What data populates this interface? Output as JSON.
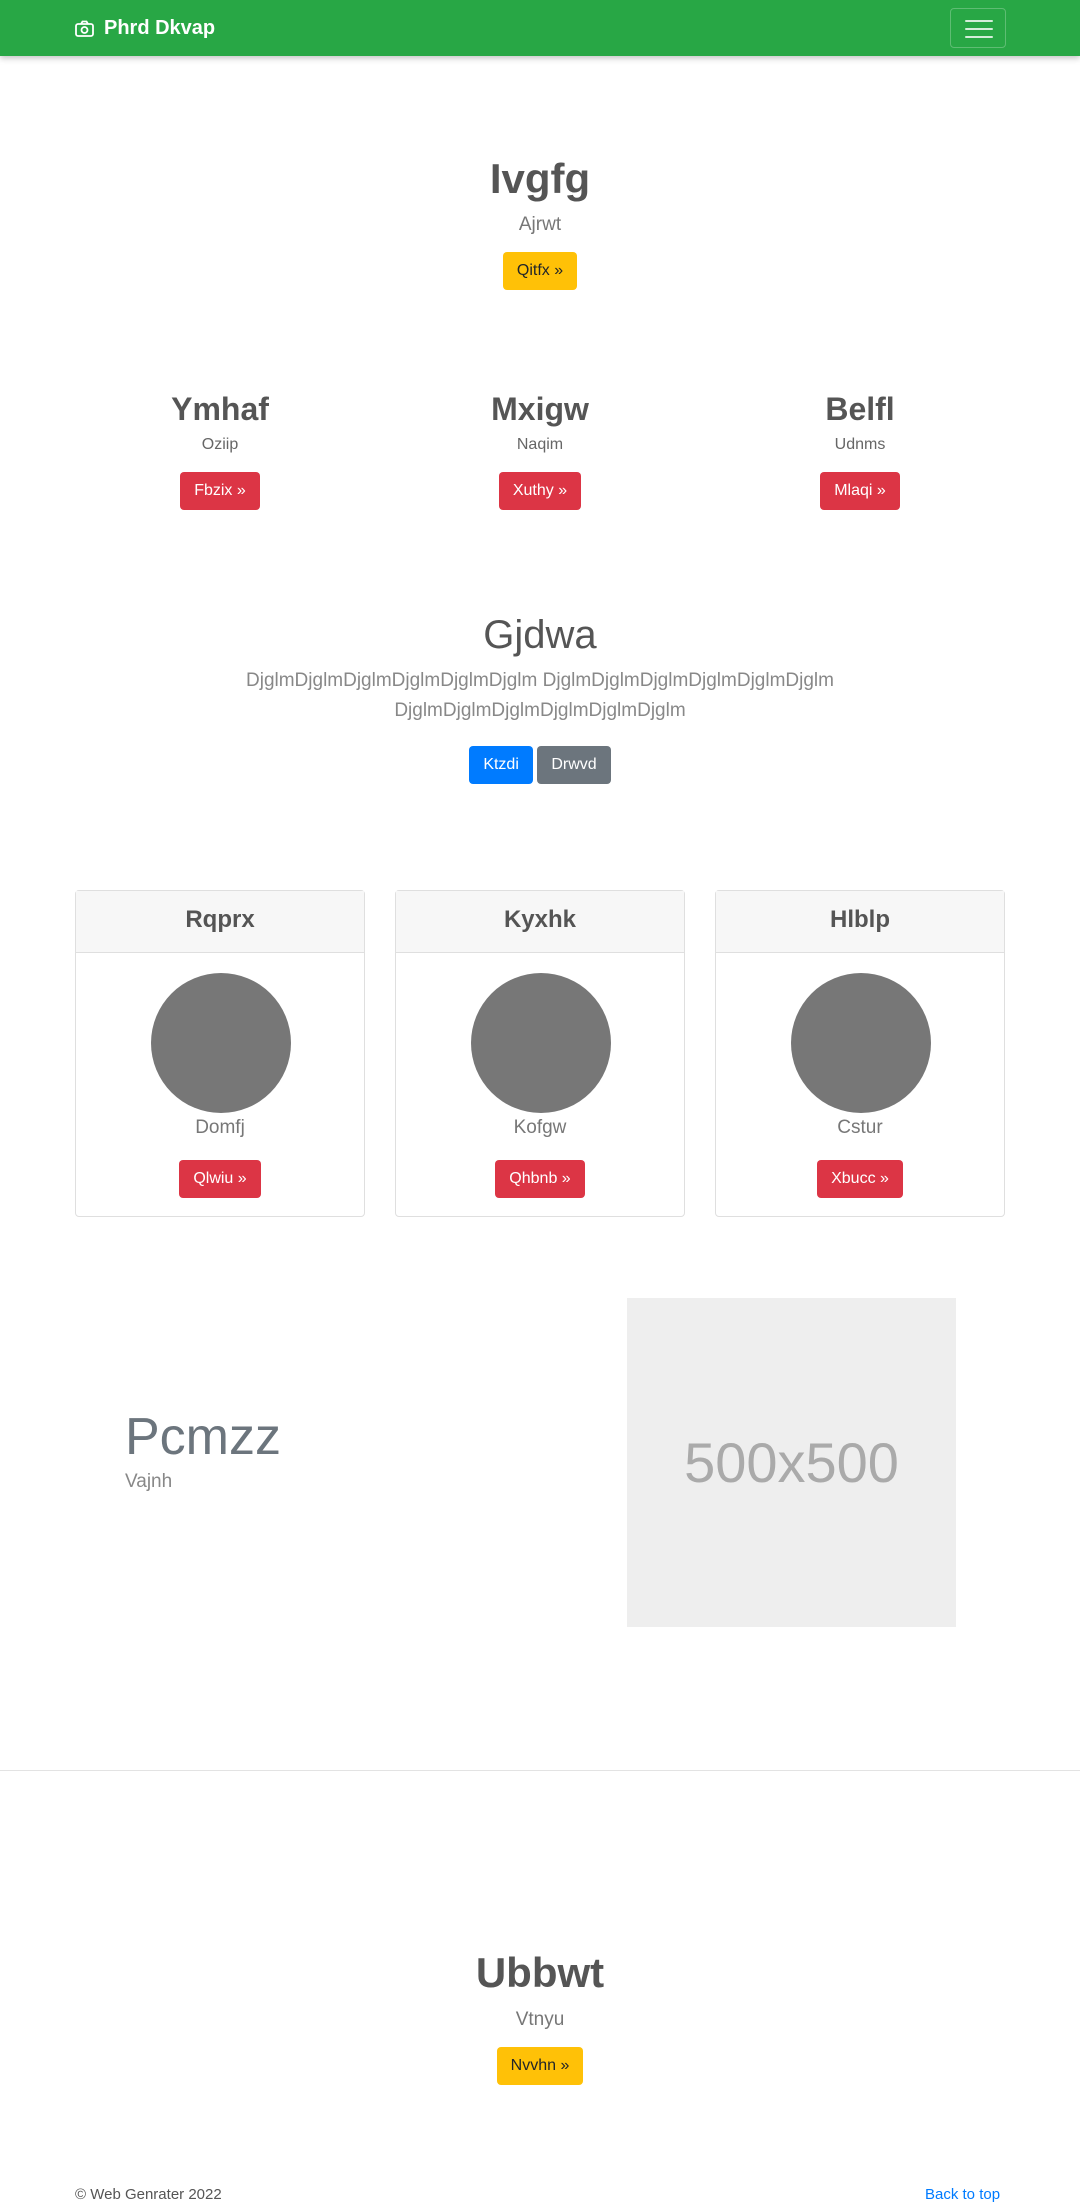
{
  "navbar": {
    "brand": "Phrd Dkvap",
    "brand_icon": "camera-icon",
    "toggle_icon": "hamburger-icon",
    "bg_color": "#28a745"
  },
  "hero": {
    "title": "Ivgfg",
    "subtitle": "Ajrwt",
    "button": "Qitfx »"
  },
  "columns": [
    {
      "title": "Ymhaf",
      "subtitle": "Oziip",
      "button": "Fbzix »"
    },
    {
      "title": "Mxigw",
      "subtitle": "Naqim",
      "button": "Xuthy »"
    },
    {
      "title": "Belfl",
      "subtitle": "Udnms",
      "button": "Mlaqi »"
    }
  ],
  "jumbo": {
    "title": "Gjdwa",
    "text_line1": "DjglmDjglmDjglmDjglmDjglmDjglm DjglmDjglmDjglmDjglmDjglmDjglm",
    "text_line2": "DjglmDjglmDjglmDjglmDjglmDjglm",
    "primary_button": "Ktzdi",
    "secondary_button": "Drwvd"
  },
  "cards": [
    {
      "header": "Rqprx",
      "name": "Domfj",
      "button": "Qlwiu »"
    },
    {
      "header": "Kyxhk",
      "name": "Kofgw",
      "button": "Qhbnb »"
    },
    {
      "header": "Hlblp",
      "name": "Cstur",
      "button": "Xbucc »"
    }
  ],
  "feature": {
    "title": "Pcmzz",
    "subtitle": "Vajnh",
    "image_label": "500x500"
  },
  "cta": {
    "title": "Ubbwt",
    "subtitle": "Vtnyu",
    "button": "Nvvhn »"
  },
  "footer": {
    "copyright": "© Web Genrater 2022",
    "back_to_top": "Back to top"
  }
}
